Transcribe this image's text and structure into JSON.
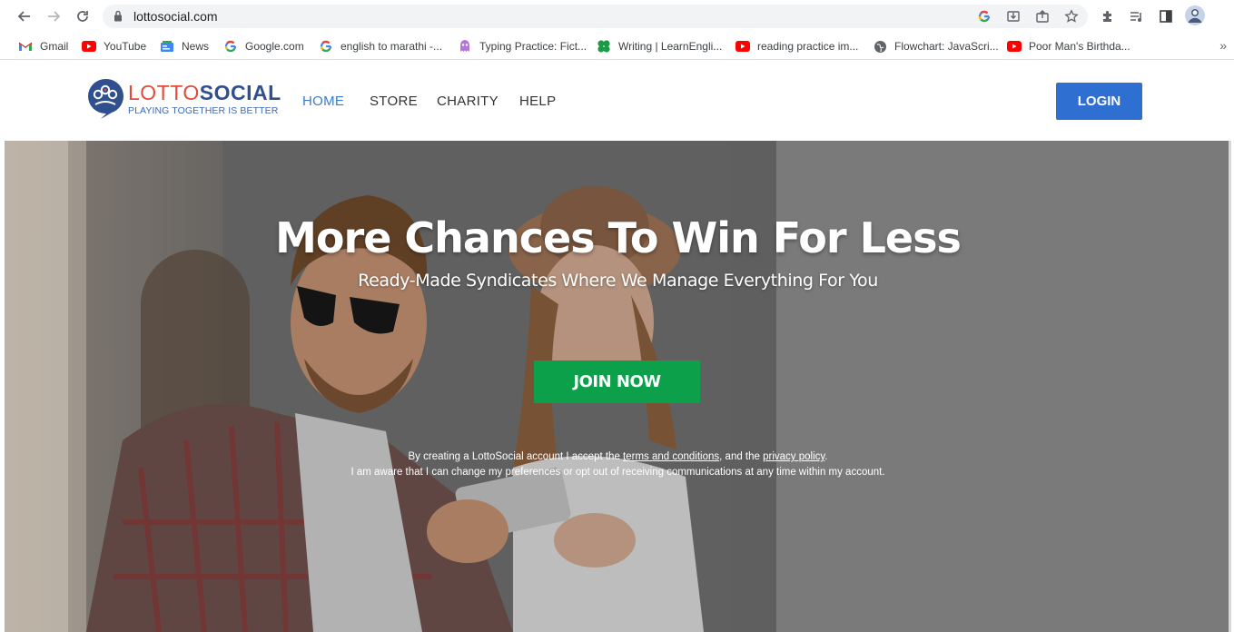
{
  "browser": {
    "url": "lottosocial.com",
    "bookmarks": [
      {
        "label": "Gmail",
        "icon": "gmail-icon"
      },
      {
        "label": "YouTube",
        "icon": "youtube-icon"
      },
      {
        "label": "News",
        "icon": "news-icon"
      },
      {
        "label": "Google.com",
        "icon": "google-icon"
      },
      {
        "label": "english to marathi -...",
        "icon": "google-icon"
      },
      {
        "label": "Typing Practice: Fict...",
        "icon": "typing-icon"
      },
      {
        "label": "Writing | LearnEngli...",
        "icon": "learnenglish-icon"
      },
      {
        "label": "reading practice im...",
        "icon": "youtube-icon"
      },
      {
        "label": "Flowchart: JavaScri...",
        "icon": "globe-icon"
      },
      {
        "label": "Poor Man's Birthda...",
        "icon": "youtube-icon"
      }
    ],
    "more_symbol": "»"
  },
  "site": {
    "logo": {
      "lotto": "LOTTO",
      "social": "SOCIAL",
      "tagline": "PLAYING TOGETHER IS BETTER"
    },
    "nav": [
      {
        "label": "HOME",
        "active": true
      },
      {
        "label": "STORE",
        "active": false
      },
      {
        "label": "CHARITY",
        "active": false
      },
      {
        "label": "HELP",
        "active": false
      }
    ],
    "login_label": "LOGIN"
  },
  "hero": {
    "title": "More Chances To Win For Less",
    "subtitle": "Ready-Made Syndicates Where We Manage Everything For You",
    "join_label": "JOIN NOW",
    "consent_part1": "By creating a LottoSocial account I accept the ",
    "terms_link": "terms and conditions",
    "consent_part2": ", and the ",
    "privacy_link": "privacy policy",
    "consent_part3": ".",
    "consent_line2": "I am aware that I can change my preferences or opt out of receiving communications at any time within my account."
  },
  "colors": {
    "accent_blue": "#2f6fd1",
    "join_green": "#0da04a",
    "logo_red": "#e04b3a",
    "logo_navy": "#2f4f8f",
    "nav_active": "#3b7bc9"
  }
}
